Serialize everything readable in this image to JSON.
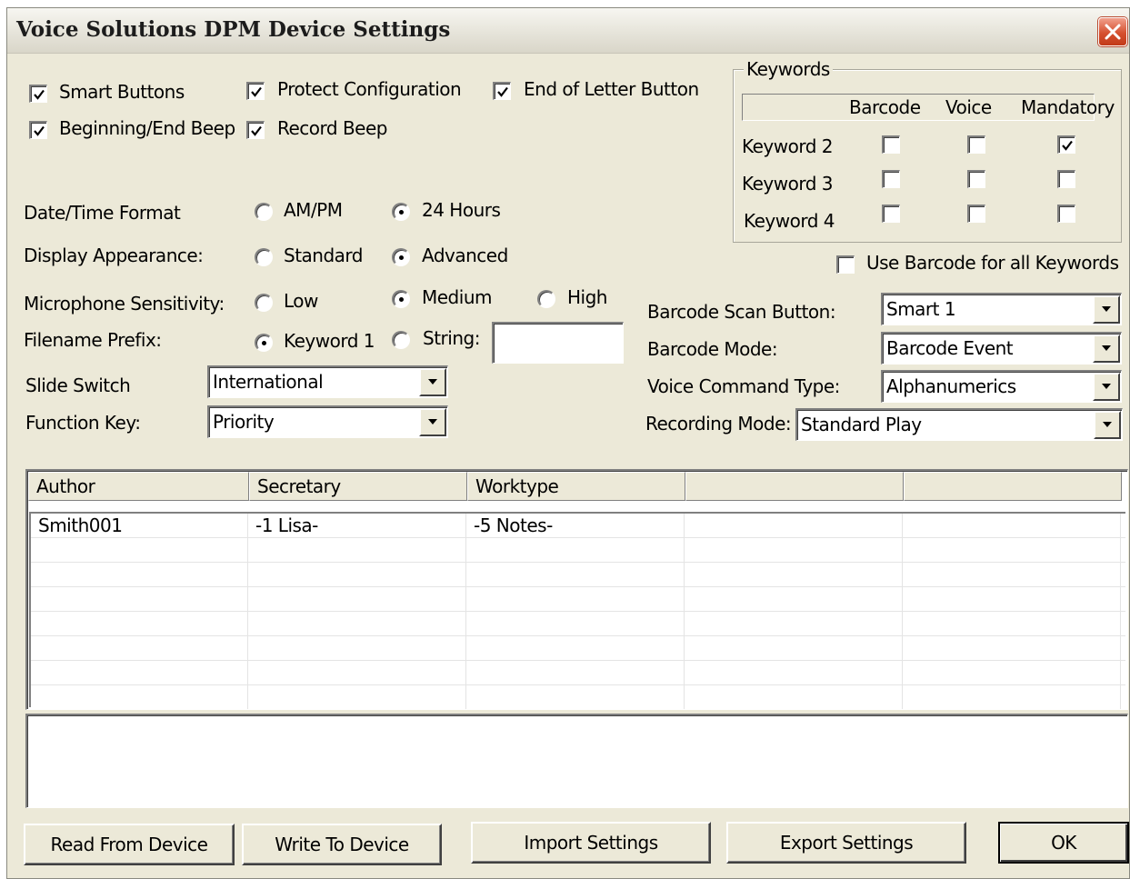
{
  "window": {
    "title": "Voice Solutions DPM Device Settings",
    "close_icon": "close-icon"
  },
  "options": {
    "smart_buttons": {
      "label": "Smart Buttons",
      "checked": true
    },
    "protect_configuration": {
      "label": "Protect Configuration",
      "checked": true
    },
    "end_of_letter_button": {
      "label": "End of Letter Button",
      "checked": true
    },
    "beginning_end_beep": {
      "label": "Beginning/End Beep",
      "checked": true
    },
    "record_beep": {
      "label": "Record Beep",
      "checked": true
    }
  },
  "date_time_format": {
    "label": "Date/Time Format",
    "options": [
      "AM/PM",
      "24 Hours"
    ],
    "selected": "24 Hours"
  },
  "display_appearance": {
    "label": "Display Appearance:",
    "options": [
      "Standard",
      "Advanced"
    ],
    "selected": "Advanced"
  },
  "microphone_sensitivity": {
    "label": "Microphone Sensitivity:",
    "options": [
      "Low",
      "Medium",
      "High"
    ],
    "selected": "Medium"
  },
  "filename_prefix": {
    "label": "Filename Prefix:",
    "options": [
      "Keyword 1",
      "String:"
    ],
    "selected": "Keyword 1",
    "string_value": ""
  },
  "slide_switch": {
    "label": "Slide Switch",
    "value": "International"
  },
  "function_key": {
    "label": "Function Key:",
    "value": "Priority"
  },
  "keywords": {
    "group_title": "Keywords",
    "columns": [
      "Barcode",
      "Voice",
      "Mandatory"
    ],
    "rows": [
      {
        "label": "Keyword 2",
        "barcode": false,
        "voice": false,
        "mandatory": true
      },
      {
        "label": "Keyword 3",
        "barcode": false,
        "voice": false,
        "mandatory": false
      },
      {
        "label": "Keyword 4",
        "barcode": false,
        "voice": false,
        "mandatory": false
      }
    ],
    "use_barcode_all": {
      "label": "Use Barcode for all Keywords",
      "checked": false
    }
  },
  "barcode_scan_button": {
    "label": "Barcode Scan Button:",
    "value": "Smart 1"
  },
  "barcode_mode": {
    "label": "Barcode Mode:",
    "value": "Barcode Event"
  },
  "voice_command_type": {
    "label": "Voice Command Type:",
    "value": "Alphanumerics"
  },
  "recording_mode": {
    "label": "Recording Mode:",
    "value": "Standard Play"
  },
  "table": {
    "columns": [
      "Author",
      "Secretary",
      "Worktype",
      "",
      ""
    ],
    "rows": [
      [
        "Smith001",
        "-1 Lisa-",
        "-5 Notes-",
        "",
        ""
      ]
    ]
  },
  "buttons": {
    "read": "Read From Device",
    "write": "Write To Device",
    "import": "Import Settings",
    "export": "Export Settings",
    "ok": "OK"
  }
}
